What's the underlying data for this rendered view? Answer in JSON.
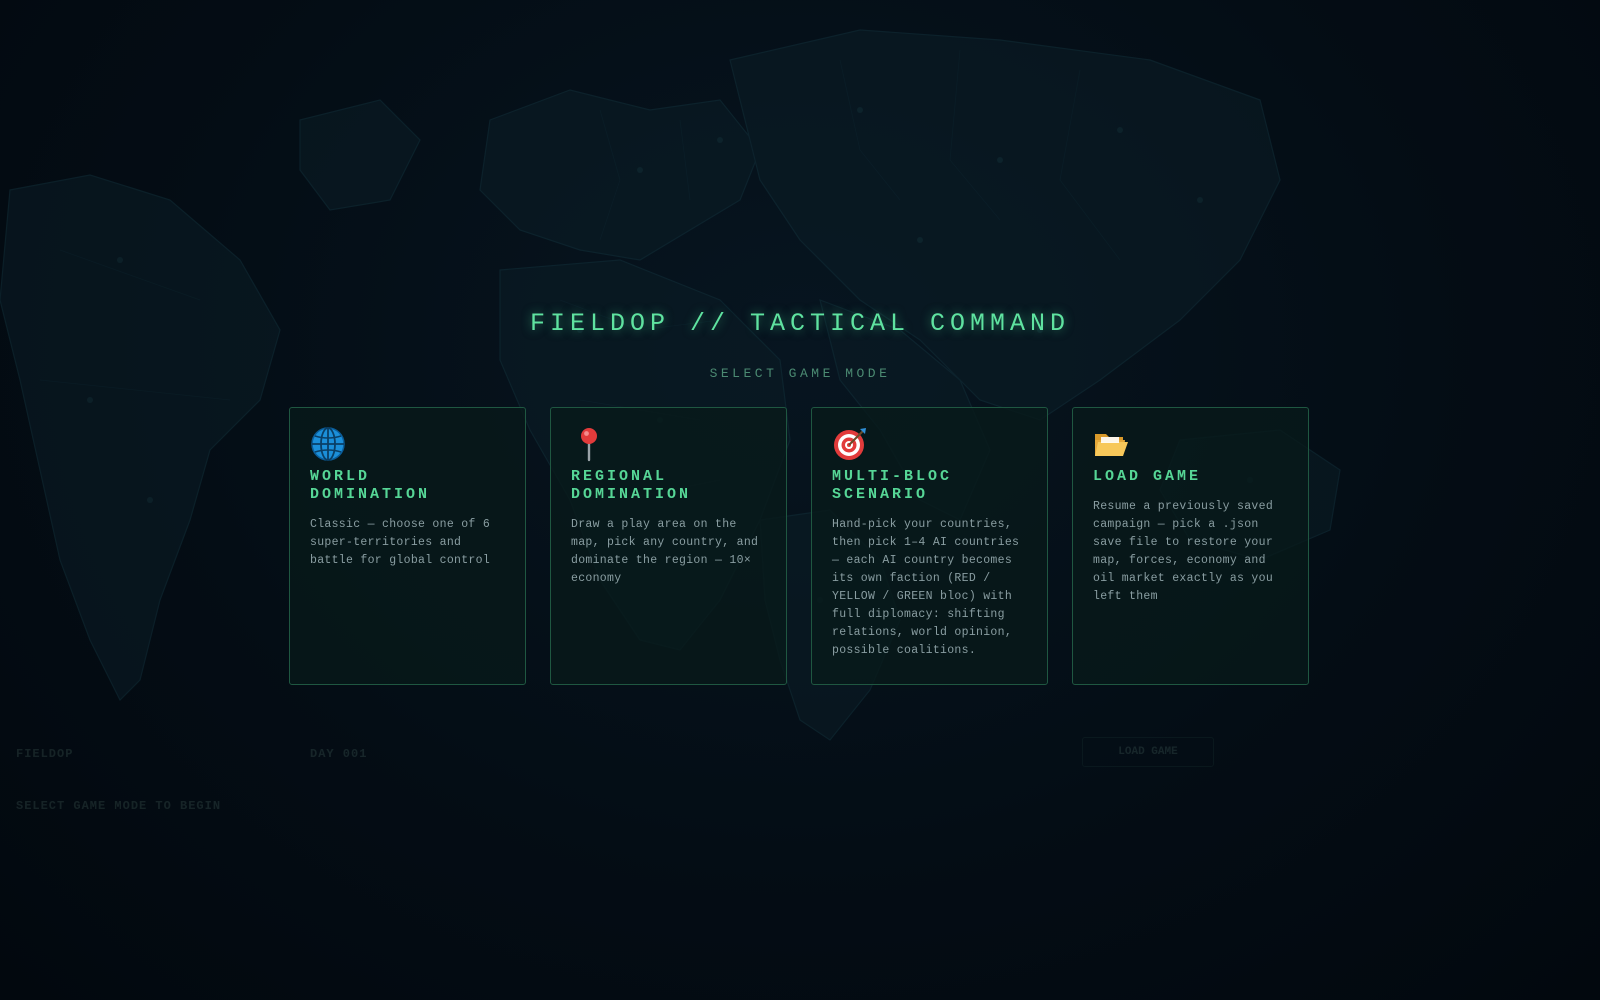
{
  "title": "FIELDOP // TACTICAL COMMAND",
  "subtitle": "SELECT GAME MODE",
  "modes": [
    {
      "icon": "globe-icon",
      "title_line1": "WORLD",
      "title_line2": "DOMINATION",
      "description": "Classic — choose one of 6 super-territories and battle for global control"
    },
    {
      "icon": "map-pin-icon",
      "title_line1": "REGIONAL",
      "title_line2": "DOMINATION",
      "description": "Draw a play area on the map, pick any country, and dominate the region — 10× economy"
    },
    {
      "icon": "target-icon",
      "title_line1": "MULTI-BLOC",
      "title_line2": "SCENARIO",
      "description": "Hand-pick your countries, then pick 1–4 AI countries — each AI country becomes its own faction (RED / YELLOW / GREEN bloc) with full diplomacy: shifting relations, world opinion, possible coalitions."
    },
    {
      "icon": "folder-open-icon",
      "title_line1": "LOAD GAME",
      "title_line2": "",
      "description": "Resume a previously saved campaign — pick a .json save file to restore your map, forces, economy and oil market exactly as you left them"
    }
  ],
  "hud": {
    "brand": "FIELDOP",
    "day_label": "DAY 001",
    "status": "SELECT GAME MODE TO BEGIN",
    "load_button": "LOAD GAME"
  },
  "colors": {
    "accent": "#5fe3a0",
    "card_border": "#1f5741",
    "background": "#030b12"
  }
}
